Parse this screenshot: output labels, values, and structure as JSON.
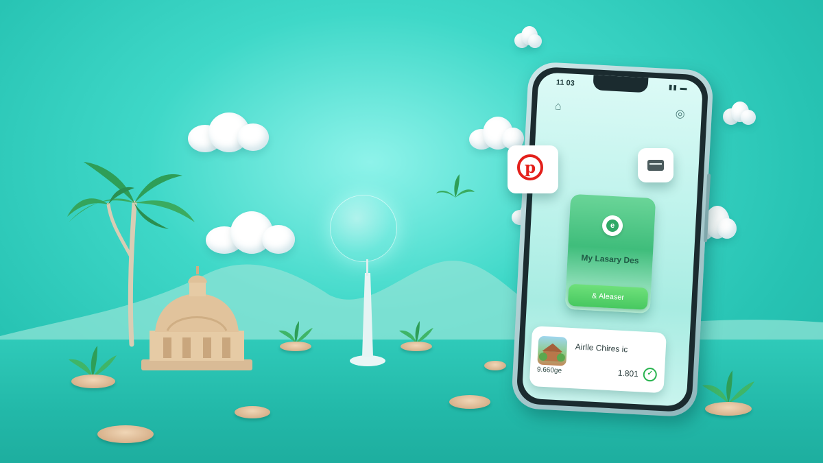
{
  "phone": {
    "status_time": "11 03",
    "status_icons": "▮▮ ▬",
    "top_left_icon": "home-icon",
    "top_right_icon": "profile-icon",
    "card": {
      "logo_icon": "app-logo-icon",
      "logo_glyph": "e",
      "title": "My Lasary Des",
      "button_label": "& Aleaser"
    },
    "list_item": {
      "thumbnail_icon": "temple-thumbnail",
      "title": "Airlle Chires ic",
      "subtitle": "9.660ge",
      "price": "1.801",
      "check_glyph": "✓"
    }
  },
  "floating_tiles": {
    "pinterest": {
      "icon": "pinterest-icon",
      "glyph": "p",
      "color": "#e3201b"
    },
    "wallet": {
      "icon": "wallet-icon"
    }
  },
  "colors": {
    "background": "#3fd8c8",
    "accent_green": "#3fbd7b",
    "pinterest_red": "#e3201b"
  }
}
